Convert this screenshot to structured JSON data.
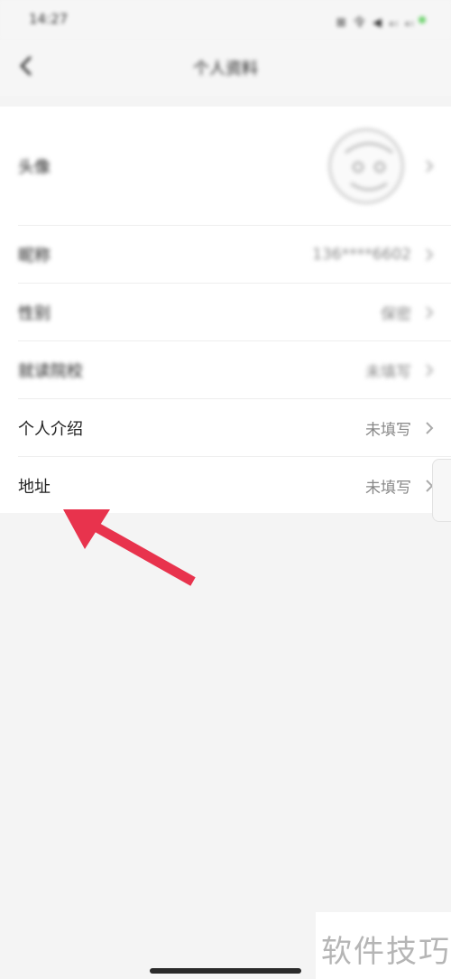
{
  "status_bar": {
    "time": "14:27",
    "icons": "⊠ 令 ◀ ₄ₗ ₄ₗ",
    "battery_color": "#6fd36f"
  },
  "nav": {
    "title": "个人资料",
    "back_icon": "chevron-left-icon"
  },
  "rows": [
    {
      "label": "头像",
      "value": ""
    },
    {
      "label": "昵称",
      "value": "136****6602"
    },
    {
      "label": "性别",
      "value": "保密"
    },
    {
      "label": "就读院校",
      "value": "未填写"
    },
    {
      "label": "个人介绍",
      "value": "未填写"
    },
    {
      "label": "地址",
      "value": "未填写"
    }
  ],
  "annotation": {
    "arrow_color": "#e8334d"
  },
  "watermark": {
    "text": "软件技巧"
  },
  "colors": {
    "background": "#f4f4f4",
    "list_background": "#ffffff",
    "value_text": "#888888"
  }
}
